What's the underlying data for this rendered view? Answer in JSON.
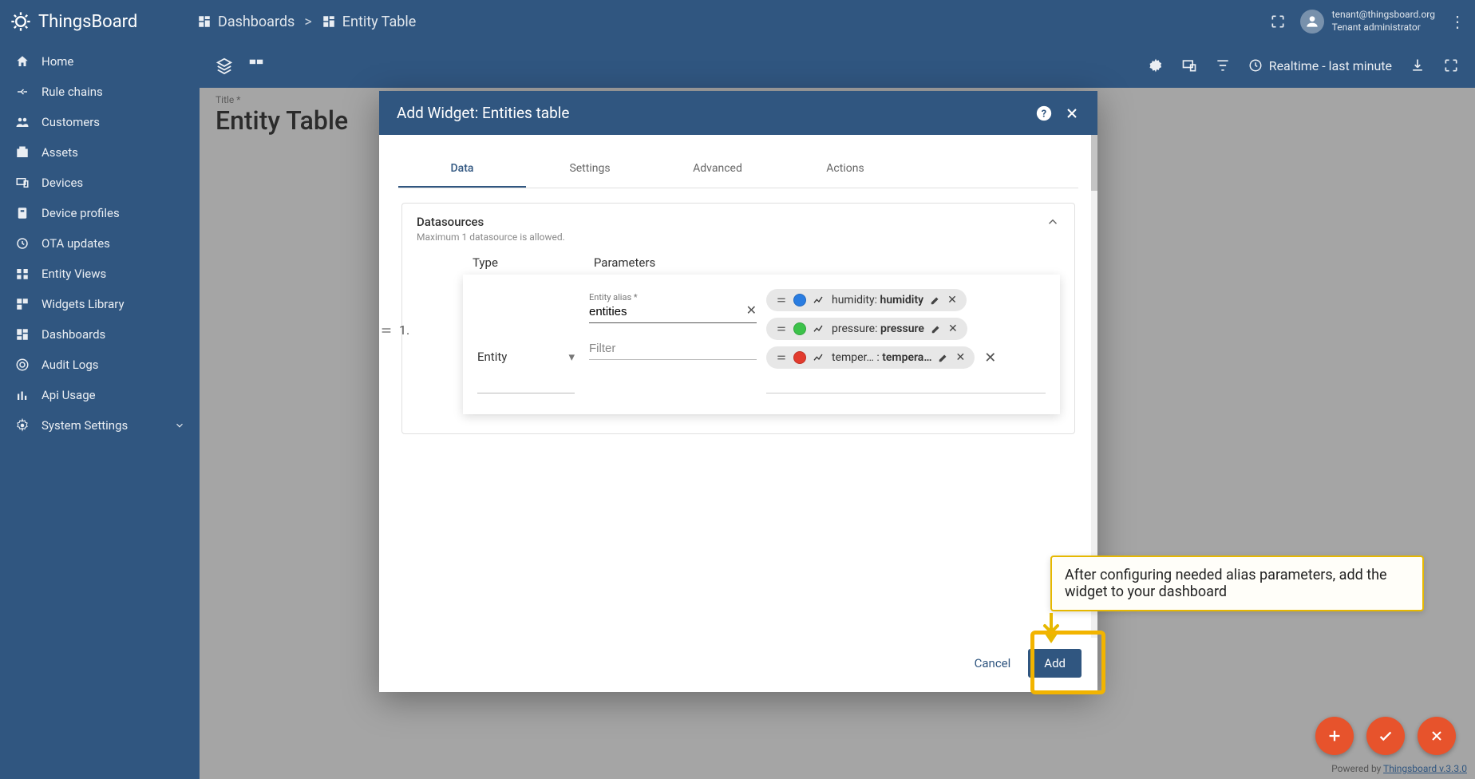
{
  "branding": {
    "name": "ThingsBoard"
  },
  "breadcrumb": {
    "root": "Dashboards",
    "sep": ">",
    "current": "Entity Table"
  },
  "user": {
    "email": "tenant@thingsboard.org",
    "role": "Tenant administrator"
  },
  "sidebar": {
    "items": [
      {
        "label": "Home"
      },
      {
        "label": "Rule chains"
      },
      {
        "label": "Customers"
      },
      {
        "label": "Assets"
      },
      {
        "label": "Devices"
      },
      {
        "label": "Device profiles"
      },
      {
        "label": "OTA updates"
      },
      {
        "label": "Entity Views"
      },
      {
        "label": "Widgets Library"
      },
      {
        "label": "Dashboards"
      },
      {
        "label": "Audit Logs"
      },
      {
        "label": "Api Usage"
      },
      {
        "label": "System Settings"
      }
    ]
  },
  "toolbar": {
    "realtime": "Realtime - last minute"
  },
  "page": {
    "title_label": "Title *",
    "title": "Entity Table"
  },
  "modal": {
    "title": "Add Widget: Entities table",
    "tabs": {
      "data": "Data",
      "settings": "Settings",
      "advanced": "Advanced",
      "actions": "Actions"
    },
    "datasources": {
      "heading": "Datasources",
      "hint": "Maximum 1 datasource is allowed.",
      "cols": {
        "type": "Type",
        "params": "Parameters"
      },
      "row_index": "1.",
      "type_value": "Entity",
      "alias_label": "Entity alias *",
      "alias_value": "entities",
      "filter_placeholder": "Filter",
      "chips": [
        {
          "key": "humidity",
          "label": "humidity",
          "color": "blue"
        },
        {
          "key": "pressure",
          "label": "pressure",
          "color": "green"
        },
        {
          "key": "temper…",
          "label": "tempera…",
          "color": "red"
        }
      ]
    },
    "buttons": {
      "cancel": "Cancel",
      "add": "Add"
    }
  },
  "callout": {
    "text": "After configuring needed alias parameters, add the widget to your dashboard"
  },
  "footer": {
    "prefix": "Powered by ",
    "link": "Thingsboard v.3.3.0"
  }
}
